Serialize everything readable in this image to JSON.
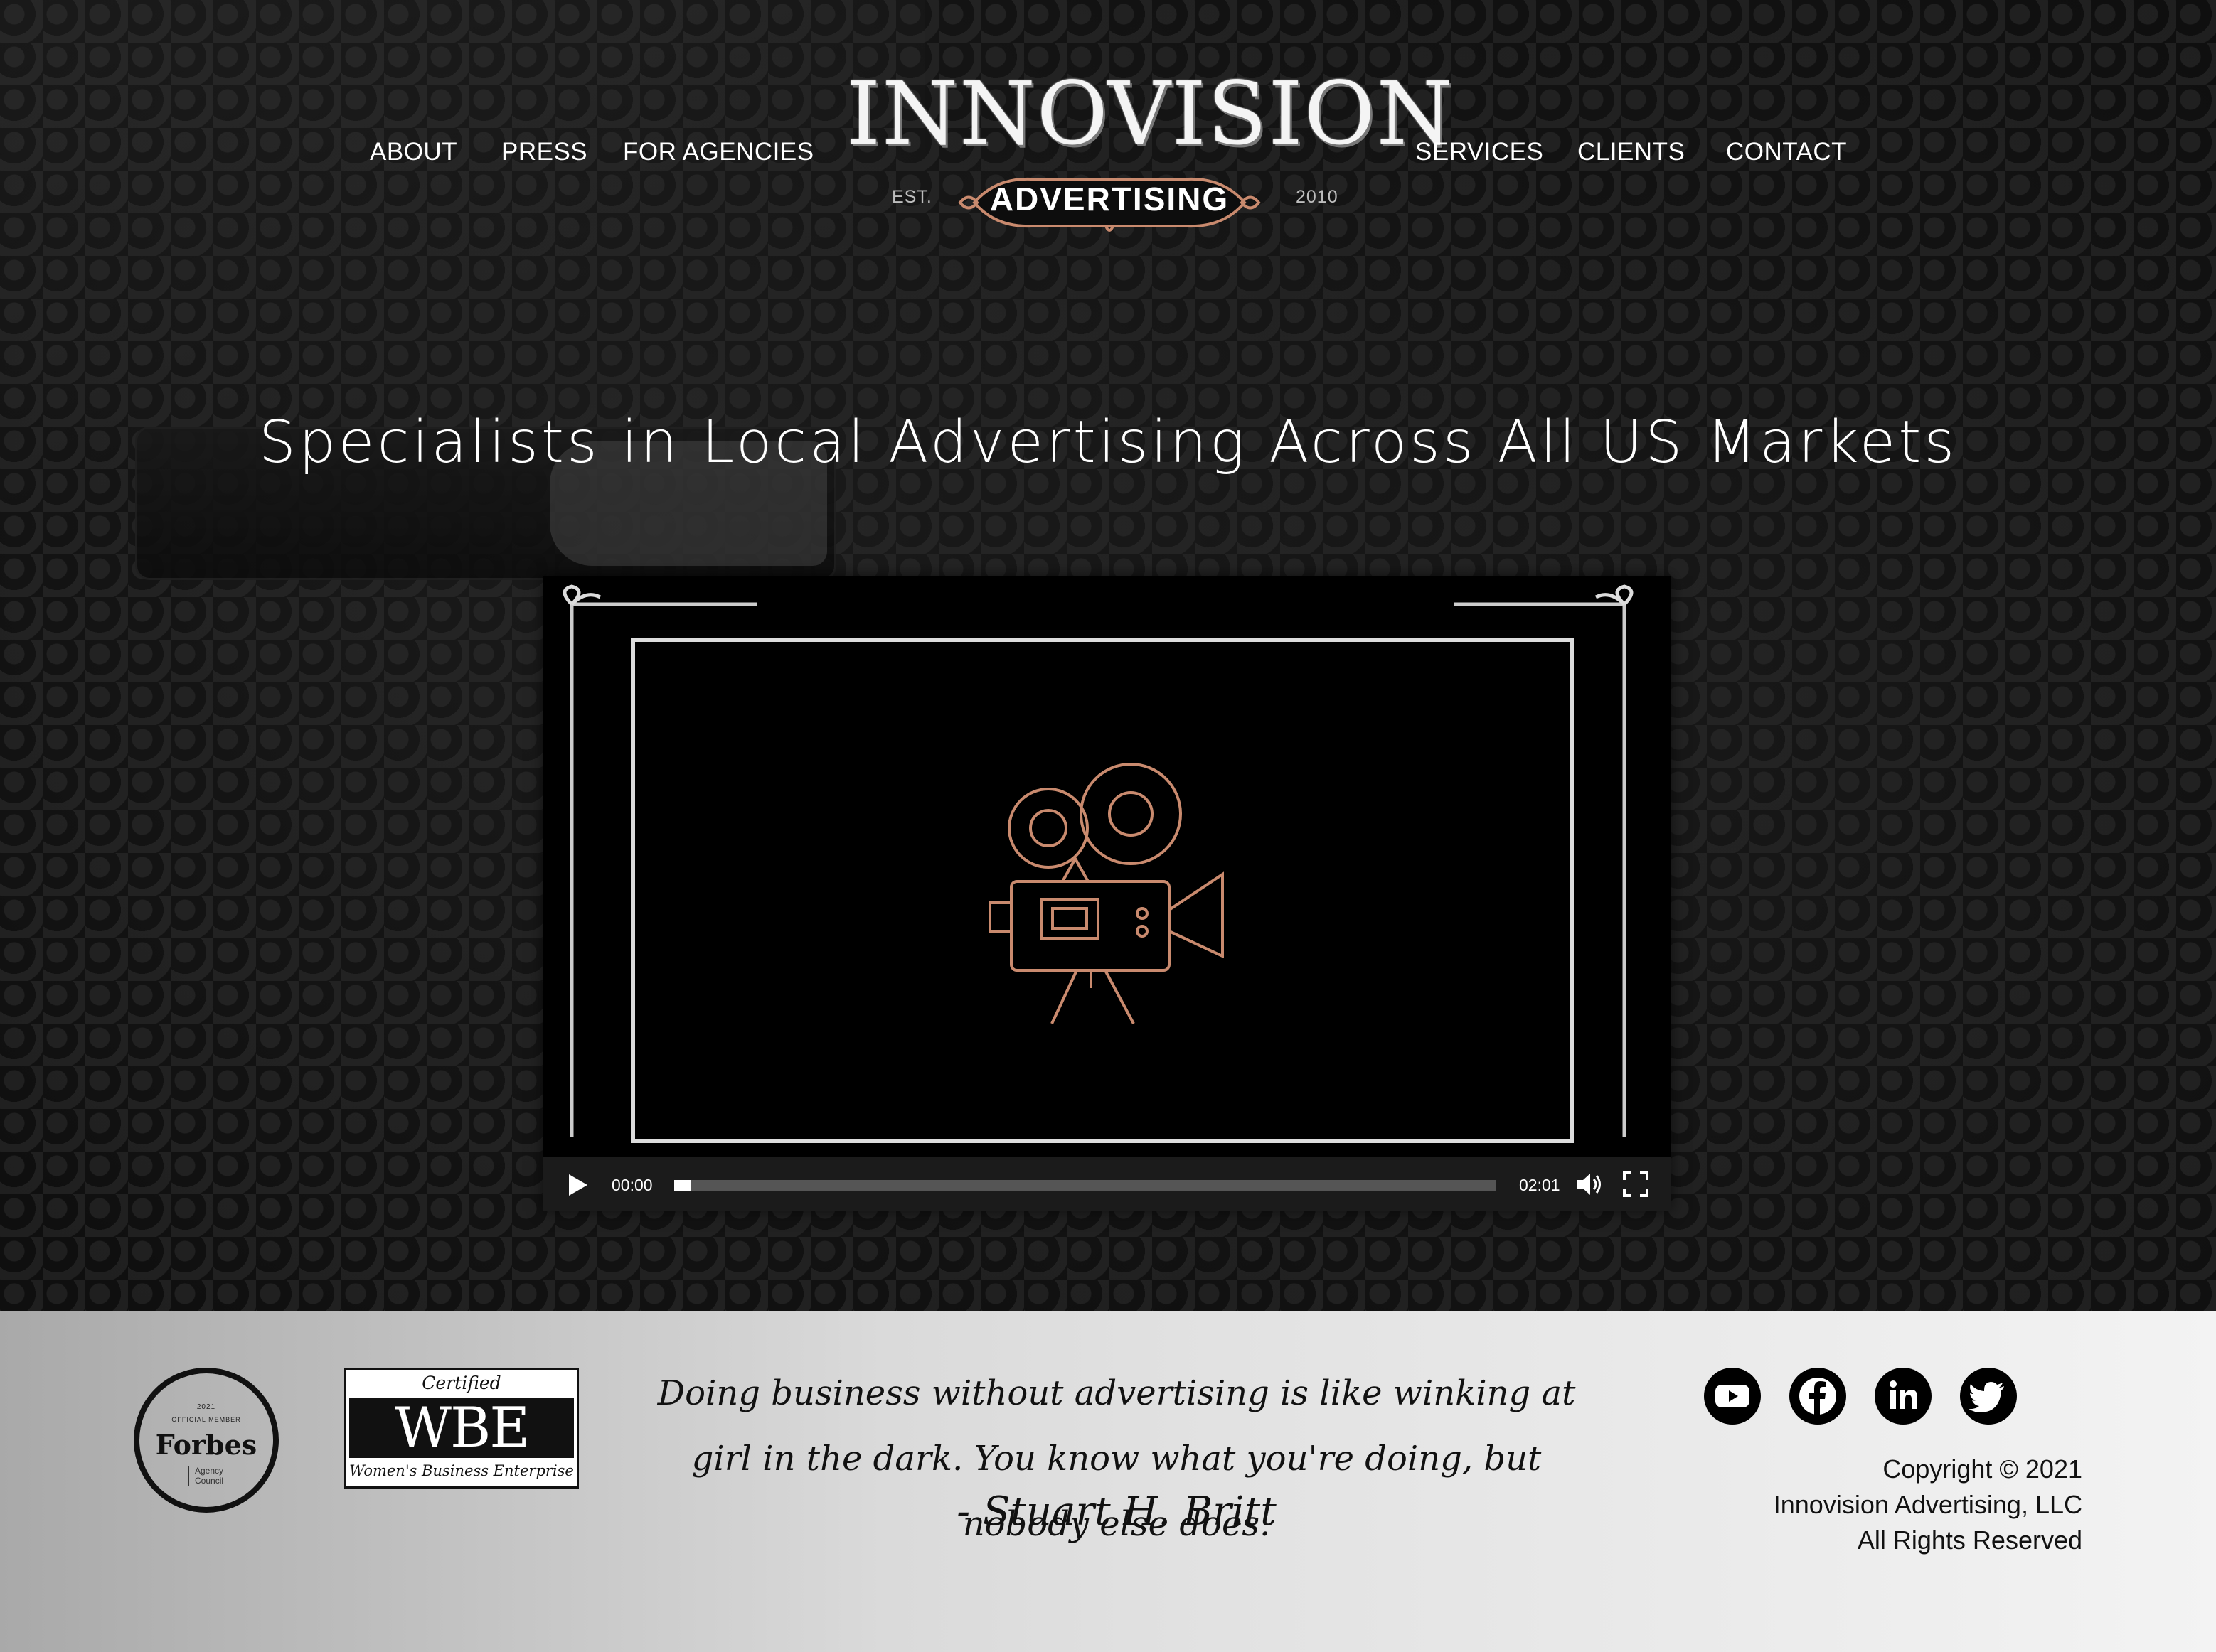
{
  "nav": {
    "left": [
      "ABOUT",
      "PRESS",
      "FOR AGENCIES"
    ],
    "right": [
      "SERVICES",
      "CLIENTS",
      "CONTACT"
    ]
  },
  "logo": {
    "name": "INNOVISION",
    "banner": "ADVERTISING",
    "est": "EST.",
    "year": "2010"
  },
  "hero": {
    "headline": "Specialists in Local Advertising Across All US Markets"
  },
  "video": {
    "current_time": "00:00",
    "duration": "02:01",
    "progress_fraction": 0.02
  },
  "footer": {
    "forbes": {
      "year": "2021",
      "label": "OFFICIAL MEMBER",
      "name": "Forbes",
      "sub": "Agency Council"
    },
    "wbe": {
      "certified": "Certified",
      "main": "WBE",
      "sub": "Women's Business Enterprise"
    },
    "quote": "Doing business without advertising is like winking at girl in the dark. You know what you're doing, but nobody else does.",
    "quote_author": "- Stuart H. Britt",
    "copyright": [
      "Copyright © 2021",
      "Innovision Advertising, LLC",
      "All Rights Reserved"
    ],
    "social": [
      "youtube-icon",
      "facebook-icon",
      "linkedin-icon",
      "twitter-icon"
    ]
  },
  "colors": {
    "accent": "#c98a6e",
    "footer_bg": "#dcdcdc",
    "text_dark": "#111111"
  }
}
